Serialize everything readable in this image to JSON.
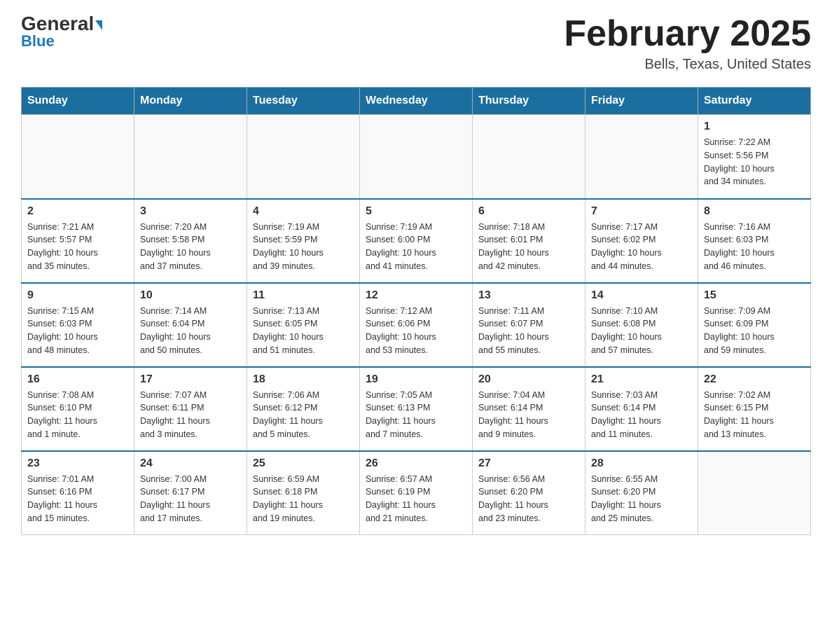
{
  "header": {
    "logo_general": "General",
    "logo_blue": "Blue",
    "month_title": "February 2025",
    "location": "Bells, Texas, United States"
  },
  "days_of_week": [
    "Sunday",
    "Monday",
    "Tuesday",
    "Wednesday",
    "Thursday",
    "Friday",
    "Saturday"
  ],
  "weeks": [
    [
      {
        "day": "",
        "info": ""
      },
      {
        "day": "",
        "info": ""
      },
      {
        "day": "",
        "info": ""
      },
      {
        "day": "",
        "info": ""
      },
      {
        "day": "",
        "info": ""
      },
      {
        "day": "",
        "info": ""
      },
      {
        "day": "1",
        "info": "Sunrise: 7:22 AM\nSunset: 5:56 PM\nDaylight: 10 hours\nand 34 minutes."
      }
    ],
    [
      {
        "day": "2",
        "info": "Sunrise: 7:21 AM\nSunset: 5:57 PM\nDaylight: 10 hours\nand 35 minutes."
      },
      {
        "day": "3",
        "info": "Sunrise: 7:20 AM\nSunset: 5:58 PM\nDaylight: 10 hours\nand 37 minutes."
      },
      {
        "day": "4",
        "info": "Sunrise: 7:19 AM\nSunset: 5:59 PM\nDaylight: 10 hours\nand 39 minutes."
      },
      {
        "day": "5",
        "info": "Sunrise: 7:19 AM\nSunset: 6:00 PM\nDaylight: 10 hours\nand 41 minutes."
      },
      {
        "day": "6",
        "info": "Sunrise: 7:18 AM\nSunset: 6:01 PM\nDaylight: 10 hours\nand 42 minutes."
      },
      {
        "day": "7",
        "info": "Sunrise: 7:17 AM\nSunset: 6:02 PM\nDaylight: 10 hours\nand 44 minutes."
      },
      {
        "day": "8",
        "info": "Sunrise: 7:16 AM\nSunset: 6:03 PM\nDaylight: 10 hours\nand 46 minutes."
      }
    ],
    [
      {
        "day": "9",
        "info": "Sunrise: 7:15 AM\nSunset: 6:03 PM\nDaylight: 10 hours\nand 48 minutes."
      },
      {
        "day": "10",
        "info": "Sunrise: 7:14 AM\nSunset: 6:04 PM\nDaylight: 10 hours\nand 50 minutes."
      },
      {
        "day": "11",
        "info": "Sunrise: 7:13 AM\nSunset: 6:05 PM\nDaylight: 10 hours\nand 51 minutes."
      },
      {
        "day": "12",
        "info": "Sunrise: 7:12 AM\nSunset: 6:06 PM\nDaylight: 10 hours\nand 53 minutes."
      },
      {
        "day": "13",
        "info": "Sunrise: 7:11 AM\nSunset: 6:07 PM\nDaylight: 10 hours\nand 55 minutes."
      },
      {
        "day": "14",
        "info": "Sunrise: 7:10 AM\nSunset: 6:08 PM\nDaylight: 10 hours\nand 57 minutes."
      },
      {
        "day": "15",
        "info": "Sunrise: 7:09 AM\nSunset: 6:09 PM\nDaylight: 10 hours\nand 59 minutes."
      }
    ],
    [
      {
        "day": "16",
        "info": "Sunrise: 7:08 AM\nSunset: 6:10 PM\nDaylight: 11 hours\nand 1 minute."
      },
      {
        "day": "17",
        "info": "Sunrise: 7:07 AM\nSunset: 6:11 PM\nDaylight: 11 hours\nand 3 minutes."
      },
      {
        "day": "18",
        "info": "Sunrise: 7:06 AM\nSunset: 6:12 PM\nDaylight: 11 hours\nand 5 minutes."
      },
      {
        "day": "19",
        "info": "Sunrise: 7:05 AM\nSunset: 6:13 PM\nDaylight: 11 hours\nand 7 minutes."
      },
      {
        "day": "20",
        "info": "Sunrise: 7:04 AM\nSunset: 6:14 PM\nDaylight: 11 hours\nand 9 minutes."
      },
      {
        "day": "21",
        "info": "Sunrise: 7:03 AM\nSunset: 6:14 PM\nDaylight: 11 hours\nand 11 minutes."
      },
      {
        "day": "22",
        "info": "Sunrise: 7:02 AM\nSunset: 6:15 PM\nDaylight: 11 hours\nand 13 minutes."
      }
    ],
    [
      {
        "day": "23",
        "info": "Sunrise: 7:01 AM\nSunset: 6:16 PM\nDaylight: 11 hours\nand 15 minutes."
      },
      {
        "day": "24",
        "info": "Sunrise: 7:00 AM\nSunset: 6:17 PM\nDaylight: 11 hours\nand 17 minutes."
      },
      {
        "day": "25",
        "info": "Sunrise: 6:59 AM\nSunset: 6:18 PM\nDaylight: 11 hours\nand 19 minutes."
      },
      {
        "day": "26",
        "info": "Sunrise: 6:57 AM\nSunset: 6:19 PM\nDaylight: 11 hours\nand 21 minutes."
      },
      {
        "day": "27",
        "info": "Sunrise: 6:56 AM\nSunset: 6:20 PM\nDaylight: 11 hours\nand 23 minutes."
      },
      {
        "day": "28",
        "info": "Sunrise: 6:55 AM\nSunset: 6:20 PM\nDaylight: 11 hours\nand 25 minutes."
      },
      {
        "day": "",
        "info": ""
      }
    ]
  ]
}
